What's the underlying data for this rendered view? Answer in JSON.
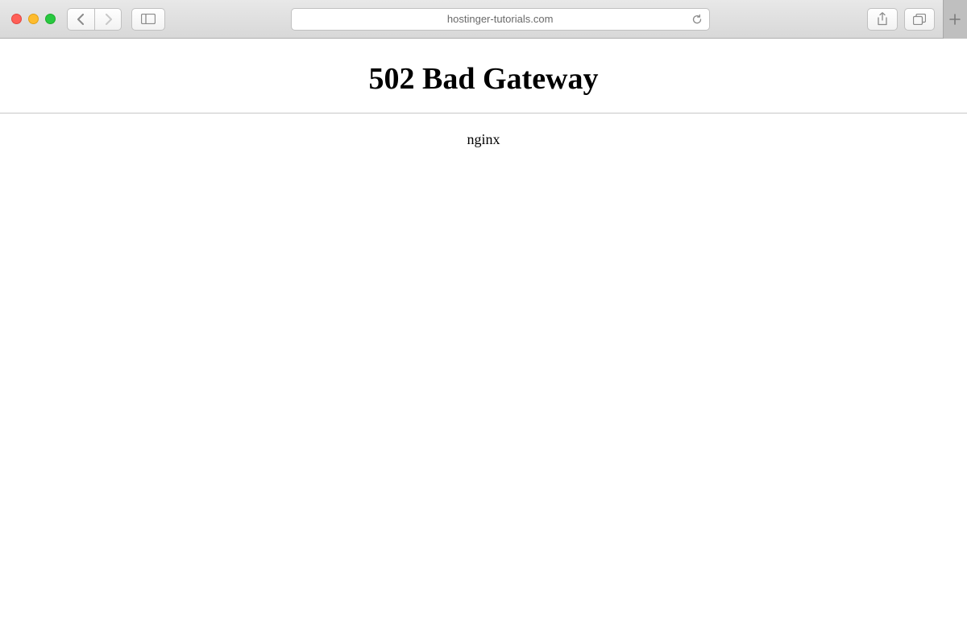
{
  "browser": {
    "address": "hostinger-tutorials.com"
  },
  "page": {
    "error_heading": "502 Bad Gateway",
    "server_label": "nginx"
  }
}
